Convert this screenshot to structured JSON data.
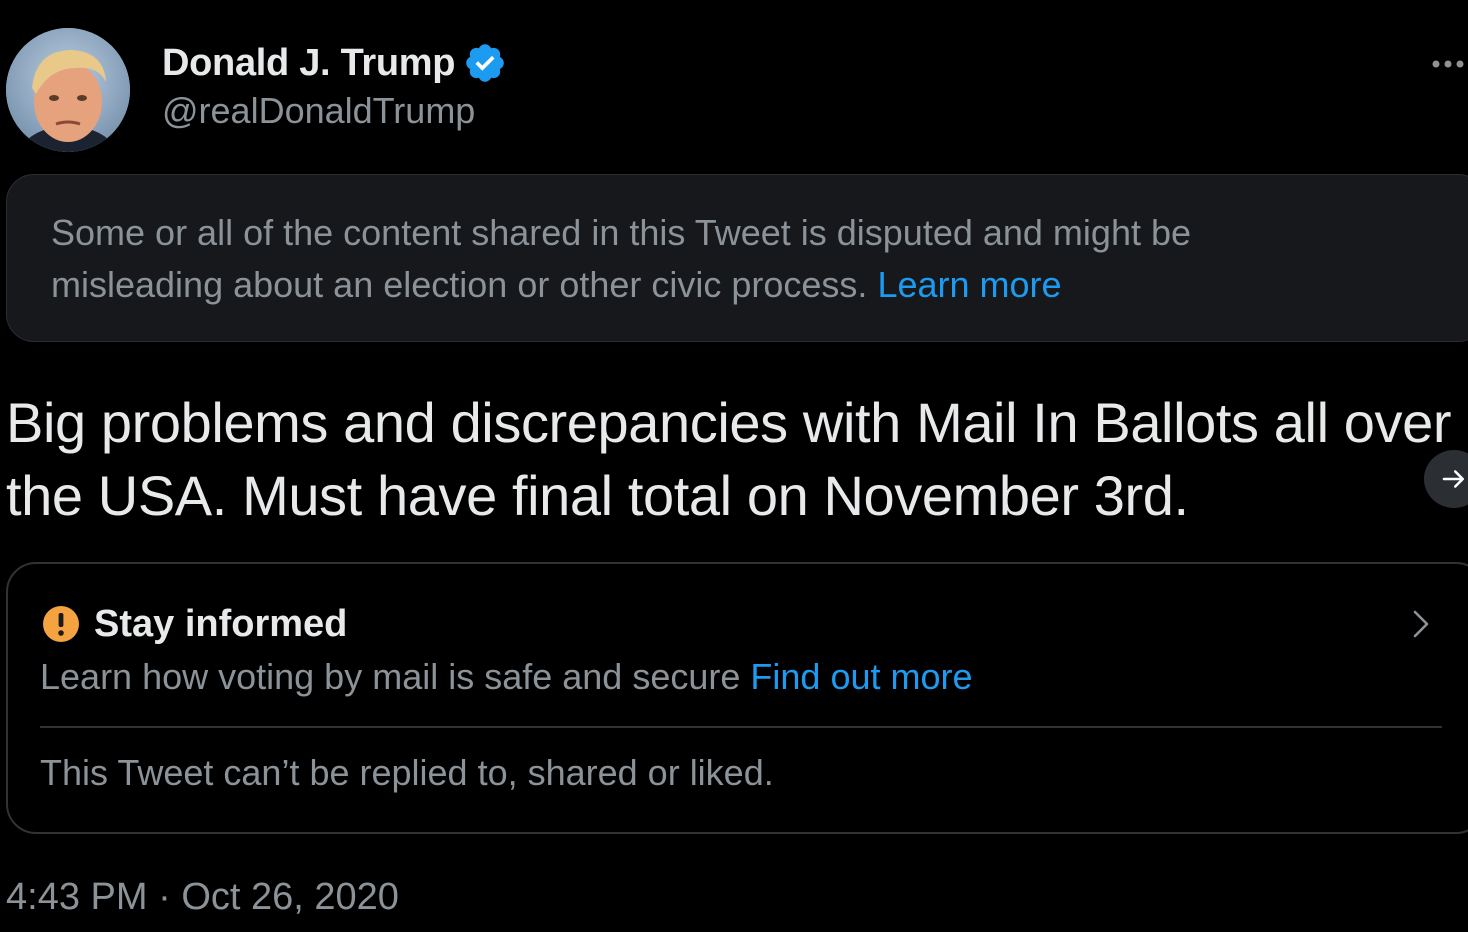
{
  "author": {
    "display_name": "Donald J. Trump",
    "handle": "@realDonaldTrump",
    "verified_icon": "verified-badge-icon"
  },
  "notice": {
    "text": "Some or all of the content shared in this Tweet is disputed and might be misleading about an election or other civic process.",
    "link": "Learn more"
  },
  "tweet": {
    "text": "Big problems and discrepancies with Mail In Ballots all over the USA. Must have final total on November 3rd."
  },
  "info_card": {
    "icon": "alert-icon",
    "title": "Stay informed",
    "subtitle": "Learn how voting by mail is safe and secure",
    "link": "Find out more",
    "restriction": "This Tweet can’t be replied to, shared or liked."
  },
  "meta": {
    "time": "4:43 PM",
    "separator": "·",
    "date": "Oct 26, 2020"
  },
  "colors": {
    "background": "#000000",
    "primary_text": "#e7e9ea",
    "secondary_text": "#8b9298",
    "link": "#1d9bf0",
    "verified": "#1d9bf0",
    "alert": "#f4a340"
  }
}
